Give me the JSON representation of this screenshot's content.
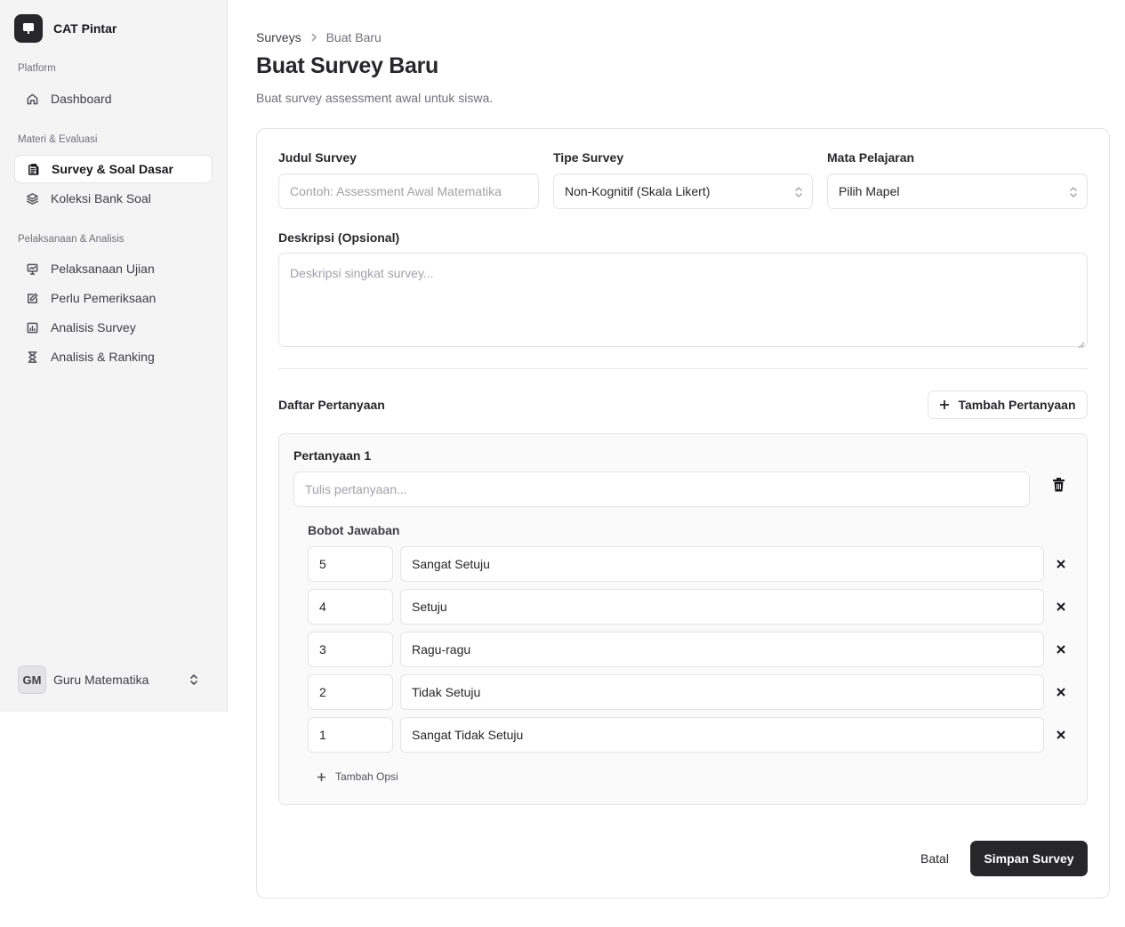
{
  "sidebar": {
    "brand": {
      "title": "CAT Pintar",
      "icon": "monitor-icon"
    },
    "groups": [
      {
        "label": "Platform"
      },
      {
        "label": "Materi & Evaluasi"
      },
      {
        "label": "Pelaksanaan & Analisis"
      }
    ],
    "items": [
      {
        "label": "Dashboard",
        "icon": "home-icon",
        "active": false
      },
      {
        "label": "Survey & Soal Dasar",
        "icon": "clipboard-icon",
        "active": true
      },
      {
        "label": "Koleksi Bank Soal",
        "icon": "layers-icon",
        "active": false
      },
      {
        "label": "Pelaksanaan Ujian",
        "icon": "presentation-icon",
        "active": false
      },
      {
        "label": "Perlu Pemeriksaan",
        "icon": "edit-icon",
        "active": false
      },
      {
        "label": "Analisis Survey",
        "icon": "bar-chart-icon",
        "active": false
      },
      {
        "label": "Analisis & Ranking",
        "icon": "hourglass-icon",
        "active": false
      }
    ],
    "user": {
      "initials": "GM",
      "name": "Guru Matematika"
    }
  },
  "breadcrumb": {
    "root": "Surveys",
    "current": "Buat Baru"
  },
  "page": {
    "title": "Buat Survey Baru",
    "subtitle": "Buat survey assessment awal untuk siswa."
  },
  "form": {
    "title_label": "Judul Survey",
    "title_placeholder": "Contoh: Assessment Awal Matematika",
    "type_label": "Tipe Survey",
    "type_value": "Non-Kognitif (Skala Likert)",
    "subject_label": "Mata Pelajaran",
    "subject_value": "Pilih Mapel",
    "description_label": "Deskripsi (Opsional)",
    "description_placeholder": "Deskripsi singkat survey..."
  },
  "questions": {
    "section_title": "Daftar Pertanyaan",
    "add_button": "Tambah Pertanyaan",
    "items": [
      {
        "label": "Pertanyaan 1",
        "placeholder": "Tulis pertanyaan...",
        "weights_label": "Bobot Jawaban",
        "options": [
          {
            "weight": "5",
            "text": "Sangat Setuju"
          },
          {
            "weight": "4",
            "text": "Setuju"
          },
          {
            "weight": "3",
            "text": "Ragu-ragu"
          },
          {
            "weight": "2",
            "text": "Tidak Setuju"
          },
          {
            "weight": "1",
            "text": "Sangat Tidak Setuju"
          }
        ],
        "add_option": "Tambah Opsi"
      }
    ]
  },
  "actions": {
    "cancel": "Batal",
    "save": "Simpan Survey"
  },
  "colors": {
    "primary": "#27272a",
    "sidebar_bg": "#f4f4f5",
    "border": "#e4e4e7",
    "muted": "#71717a"
  }
}
